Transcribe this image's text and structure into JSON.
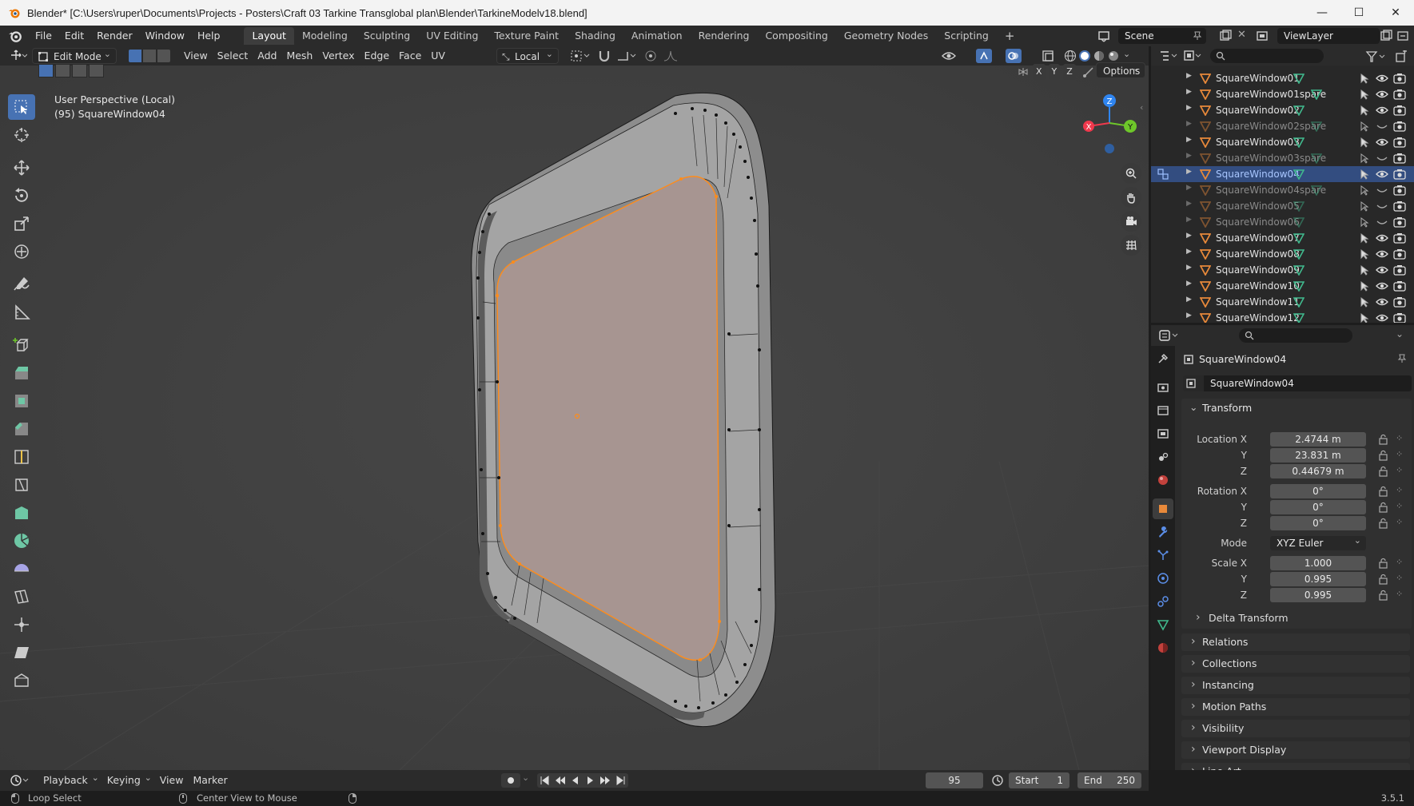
{
  "window": {
    "title": "Blender* [C:\\Users\\ruper\\Documents\\Projects - Posters\\Craft 03 Tarkine Transglobal plan\\Blender\\TarkineModelv18.blend]",
    "minimize": "—",
    "maximize": "☐",
    "close": "✕"
  },
  "menu": [
    "File",
    "Edit",
    "Render",
    "Window",
    "Help"
  ],
  "workspaces": [
    "Layout",
    "Modeling",
    "Sculpting",
    "UV Editing",
    "Texture Paint",
    "Shading",
    "Animation",
    "Rendering",
    "Compositing",
    "Geometry Nodes",
    "Scripting"
  ],
  "workspace_add": "+",
  "scene": {
    "name": "Scene",
    "view_layer": "ViewLayer"
  },
  "viewport": {
    "mode": "Edit Mode",
    "menus": [
      "View",
      "Select",
      "Add",
      "Mesh",
      "Vertex",
      "Edge",
      "Face",
      "UV"
    ],
    "transform_orientation": "Local",
    "options": "Options",
    "perspective": "User Perspective (Local)",
    "object_label": "(95) SquareWindow04",
    "gizmo": {
      "x": "X",
      "y": "Y",
      "z": "Z"
    },
    "axis_lock": [
      "X",
      "Y",
      "Z"
    ]
  },
  "outliner": {
    "rows": [
      {
        "name": "SquareWindow01",
        "dim": false,
        "selected": false
      },
      {
        "name": "SquareWindow01spare",
        "dim": false,
        "selected": false
      },
      {
        "name": "SquareWindow02",
        "dim": false,
        "selected": false
      },
      {
        "name": "SquareWindow02spare",
        "dim": true,
        "selected": false
      },
      {
        "name": "SquareWindow03",
        "dim": false,
        "selected": false
      },
      {
        "name": "SquareWindow03spare",
        "dim": true,
        "selected": false
      },
      {
        "name": "SquareWindow04",
        "dim": false,
        "selected": true
      },
      {
        "name": "SquareWindow04spare",
        "dim": true,
        "selected": false
      },
      {
        "name": "SquareWindow05",
        "dim": true,
        "selected": false
      },
      {
        "name": "SquareWindow06",
        "dim": true,
        "selected": false
      },
      {
        "name": "SquareWindow07",
        "dim": false,
        "selected": false
      },
      {
        "name": "SquareWindow08",
        "dim": false,
        "selected": false
      },
      {
        "name": "SquareWindow09",
        "dim": false,
        "selected": false
      },
      {
        "name": "SquareWindow10",
        "dim": false,
        "selected": false
      },
      {
        "name": "SquareWindow11",
        "dim": false,
        "selected": false
      },
      {
        "name": "SquareWindow12",
        "dim": false,
        "selected": false
      }
    ]
  },
  "properties": {
    "object_name": "SquareWindow04",
    "datablock": "SquareWindow04",
    "transform": {
      "title": "Transform",
      "location_label": "Location X",
      "y_label": "Y",
      "z_label": "Z",
      "rotation_label": "Rotation X",
      "scale_label": "Scale X",
      "mode_label": "Mode",
      "location": [
        "2.4744 m",
        "23.831 m",
        "0.44679 m"
      ],
      "rotation": [
        "0°",
        "0°",
        "0°"
      ],
      "mode": "XYZ Euler",
      "scale": [
        "1.000",
        "0.995",
        "0.995"
      ],
      "delta": "Delta Transform"
    },
    "panels": [
      "Relations",
      "Collections",
      "Instancing",
      "Motion Paths",
      "Visibility",
      "Viewport Display",
      "Line Art"
    ]
  },
  "timeline": {
    "menus": [
      "Playback",
      "Keying",
      "View",
      "Marker"
    ],
    "current_frame": "95",
    "start_label": "Start",
    "start": "1",
    "end_label": "End",
    "end": "250"
  },
  "status": {
    "left": "Loop Select",
    "middle": "Center View to Mouse",
    "version": "3.5.1"
  },
  "colors": {
    "accent": "#4772b3",
    "selection_orange": "#ff8c1a",
    "axis_x": "#f0394d",
    "axis_y": "#6ec72a",
    "axis_z": "#2f85f0",
    "mesh_icon_orange": "#e8893a",
    "mesh_data_green": "#40b98d"
  }
}
